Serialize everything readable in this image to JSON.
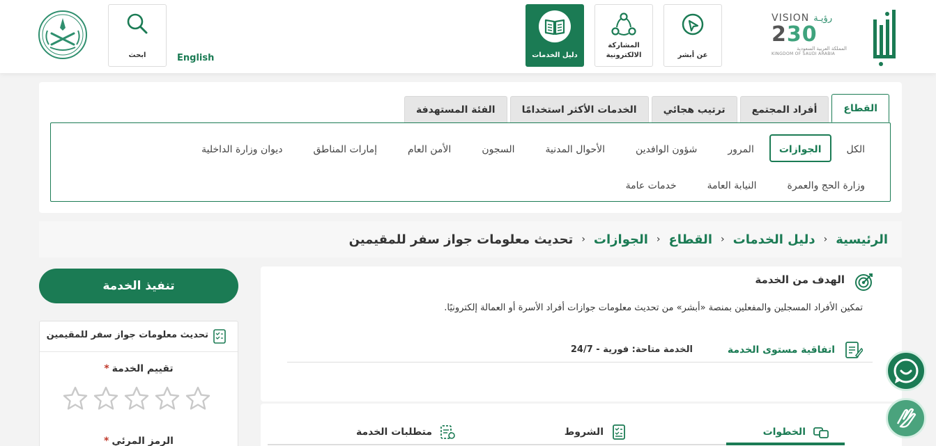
{
  "header": {
    "vision": {
      "word": "VISION",
      "arabic": "رؤيـة",
      "year_a": "2",
      "year_b": "30",
      "year_c": "30",
      "country_ar": "المملكة العربية السعودية",
      "country_en": "KINGDOM OF SAUDI ARABIA"
    },
    "nav": [
      {
        "label": "عن أبشر",
        "icon": "about-icon"
      },
      {
        "label": "المشاركة الالكترونية",
        "icon": "participation-icon"
      },
      {
        "label": "دليل الخدمات",
        "icon": "services-guide-icon",
        "active": true
      }
    ],
    "english": "English",
    "search_label": "ابحث"
  },
  "sector": {
    "tabs": [
      "القطاع",
      "أفراد المجتمع",
      "ترتيب هجائي",
      "الخدمات الأكثر استخدامًا",
      "الفئة المستهدفة"
    ],
    "active_tab": "القطاع",
    "chips": [
      "الكل",
      "الجوازات",
      "المرور",
      "شؤون الوافدين",
      "الأحوال المدنية",
      "السجون",
      "الأمن العام",
      "إمارات المناطق",
      "ديوان وزارة الداخلية",
      "وزارة الحج والعمرة",
      "النيابة العامة",
      "خدمات عامة"
    ],
    "active_chip": "الجوازات"
  },
  "breadcrumb": [
    "الرئيسية",
    "دليل الخدمات",
    "القطاع",
    "الجوازات",
    "تحديث معلومات جواز سفر للمقيمين"
  ],
  "service": {
    "goal_title": "الهدف من الخدمة",
    "goal_text": "تمكين الأفراد المسجلين والمفعلين بمنصة «أبشر» من تحديث معلومات جوازات أفراد الأسرة أو العمالة إلكترونيًا.",
    "sla_link": "اتفاقية مستوى الخدمة",
    "availability": "الخدمة متاحة: فورية - 24/7",
    "tabs": [
      "الخطوات",
      "الشروط",
      "متطلبات الخدمة"
    ]
  },
  "sidebar": {
    "execute": "تنفيذ الخدمة",
    "title": "تحديث معلومات جواز سفر للمقيمين",
    "rating_label": "تقييم الخدمة",
    "required_mark": "*",
    "stars": 5,
    "code_label": "الرمز المرئي"
  },
  "colors": {
    "primary": "#1b7b54",
    "accent": "#3fa37d"
  }
}
